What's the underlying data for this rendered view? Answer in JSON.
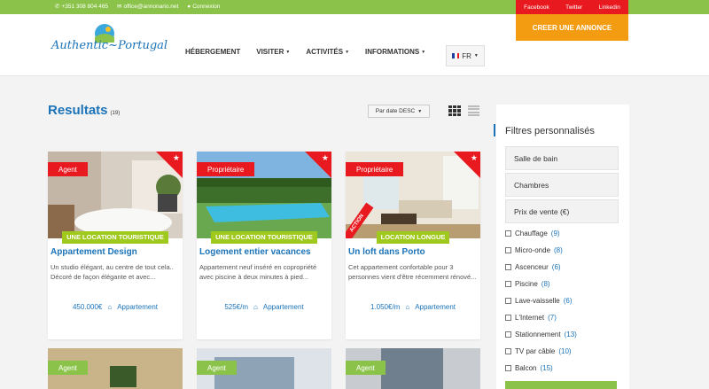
{
  "topbar": {
    "phone": "+351 308 804 465",
    "email": "office@annonario.net",
    "login": "Connexion",
    "social": [
      "Facebook",
      "Twitter",
      "Linkedin"
    ]
  },
  "header": {
    "logo_text": "Authentic~Portugal",
    "cta": "CREER UNE ANNONCE",
    "nav": [
      "HÉBERGEMENT",
      "VISITER",
      "ACTIVITÉS",
      "INFORMATIONS"
    ],
    "lang": "FR"
  },
  "results": {
    "title": "Resultats",
    "count": "(19)",
    "sort": "Par date DESC"
  },
  "cards": [
    {
      "tag": "Agent",
      "category": "UNE LOCATION TOURISTIQUE",
      "title": "Appartement Design",
      "desc": "Un studio élégant, au centre de tout cela.. Décoré de façon élégante et avec...",
      "price": "450.000€",
      "type": "Appartement"
    },
    {
      "tag": "Propriétaire",
      "category": "UNE LOCATION TOURISTIQUE",
      "title": "Logement entier vacances",
      "desc": "Appartement neuf inséré en copropriété avec piscine à deux minutes à pied...",
      "price": "525€/m",
      "type": "Appartement"
    },
    {
      "tag": "Propriétaire",
      "category": "LOCATION LONGUE",
      "title": "Un loft dans Porto",
      "desc": "Cet appartement confortable pour 3 personnes vient d'être récemment rénové...",
      "price": "1.050€/m",
      "type": "Appartement",
      "ribbon": "ACTION"
    }
  ],
  "row2_tags": [
    "Agent",
    "Agent",
    "Agent"
  ],
  "sidebar": {
    "title": "Filtres personnalisés",
    "buttons": [
      "Salle de bain",
      "Chambres",
      "Prix de vente (€)"
    ],
    "filters": [
      {
        "label": "Chauffage",
        "count": "(9)"
      },
      {
        "label": "Micro-onde",
        "count": "(8)"
      },
      {
        "label": "Ascenceur",
        "count": "(6)"
      },
      {
        "label": "Piscine",
        "count": "(8)"
      },
      {
        "label": "Lave-vaisselle",
        "count": "(6)"
      },
      {
        "label": "L'Internet",
        "count": "(7)"
      },
      {
        "label": "Stationnement",
        "count": "(13)"
      },
      {
        "label": "TV par câble",
        "count": "(10)"
      },
      {
        "label": "Balcon",
        "count": "(15)"
      }
    ]
  },
  "colors": {
    "green": "#8bc34a",
    "red": "#e8191f",
    "orange": "#f39c12",
    "blue": "#1b73b8",
    "lime": "#a0c91e"
  }
}
